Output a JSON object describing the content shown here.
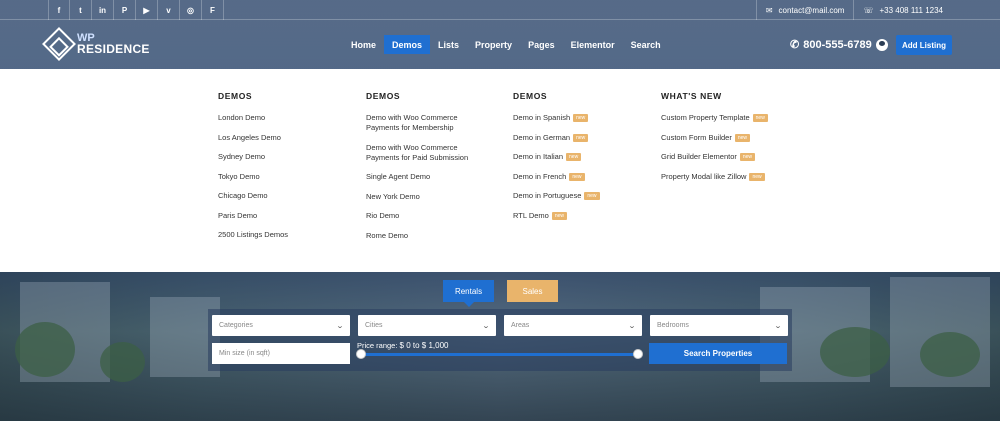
{
  "topbar": {
    "social_icons": [
      "facebook-icon",
      "twitter-icon",
      "linkedin-icon",
      "pinterest-icon",
      "youtube-icon",
      "vimeo-icon",
      "instagram-icon",
      "foursquare-icon"
    ],
    "social_glyphs": [
      "f",
      "t",
      "in",
      "P",
      "▶",
      "v",
      "◎",
      "F"
    ],
    "email": "contact@mail.com",
    "phone": "+33 408 111 1234"
  },
  "header": {
    "logo_line1": "WP",
    "logo_line2": "RESIDENCE",
    "nav": [
      "Home",
      "Demos",
      "Lists",
      "Property",
      "Pages",
      "Elementor",
      "Search"
    ],
    "active_nav": "Demos",
    "phone": "800-555-6789",
    "add_listing": "Add Listing"
  },
  "mega_menu": {
    "columns": [
      {
        "title": "DEMOS",
        "items": [
          "London Demo",
          "Los Angeles Demo",
          "Sydney Demo",
          "Tokyo Demo",
          "Chicago Demo",
          "Paris Demo",
          "2500 Listings Demos"
        ]
      },
      {
        "title": "DEMOS",
        "items": [
          "Demo with Woo Commerce Payments for Membership",
          "Demo with Woo Commerce Payments for Paid Submission",
          "Single Agent Demo",
          "New York Demo",
          "Rio Demo",
          "Rome Demo"
        ]
      },
      {
        "title": "DEMOS",
        "items": [
          "Demo in Spanish",
          "Demo in German",
          "Demo in Italian",
          "Demo in French",
          "Demo in Portuguese",
          "RTL Demo"
        ]
      },
      {
        "title": "WHAT'S NEW",
        "items": [
          "Custom Property Template",
          "Custom Form Builder",
          "Grid Builder Elementor",
          "Property Modal like Zillow"
        ]
      }
    ],
    "badge_label": "new"
  },
  "search": {
    "tabs": [
      "Rentals",
      "Sales"
    ],
    "categories_placeholder": "Categories",
    "cities_placeholder": "Cities",
    "areas_placeholder": "Areas",
    "bedrooms_placeholder": "Bedrooms",
    "min_size_placeholder": "Min size (in sqft)",
    "price_label": "Price range:",
    "price_value": "$ 0 to $ 1,000",
    "price_min_fraction": 0,
    "price_max_fraction": 1,
    "submit": "Search Properties"
  },
  "colors": {
    "accent": "#1f6fd1",
    "badge": "#e9b46b"
  }
}
